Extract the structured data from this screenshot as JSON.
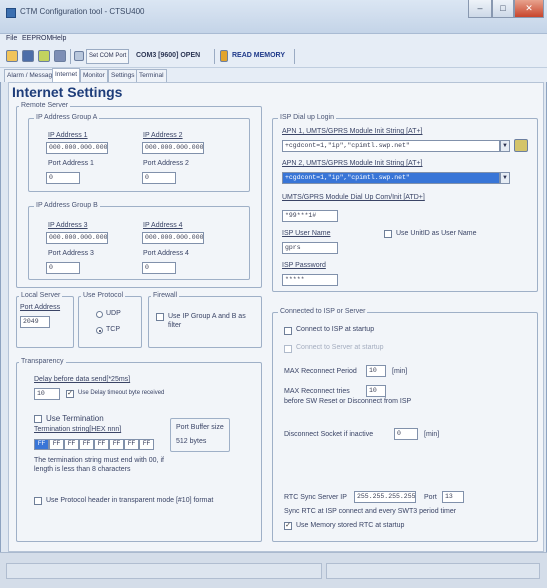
{
  "window": {
    "title": "CTM Configuration tool - CTSU400",
    "buttons": {
      "minimize": "–",
      "maximize": "□",
      "close": "✕"
    }
  },
  "menu": [
    "File",
    "EEPROM",
    "Help"
  ],
  "toolbar": {
    "set_com_port": "Set COM Port",
    "port_status": "COM3 [9600] OPEN",
    "read_memory": "READ MEMORY"
  },
  "tabs": [
    "Alarm / Message",
    "Internet",
    "Monitor",
    "Settings",
    "Terminal"
  ],
  "active_tab": "Internet",
  "page_title": "Internet Settings",
  "remote_server": {
    "label": "Remote Server",
    "group_a": {
      "label": "IP Address Group A",
      "ip1_label": "IP Address 1",
      "ip1": "000.000.000.000",
      "ip2_label": "IP Address 2",
      "ip2": "000.000.000.000",
      "port1_label": "Port Address 1",
      "port1": "0",
      "port2_label": "Port Address 2",
      "port2": "0"
    },
    "group_b": {
      "label": "IP Address Group B",
      "ip3_label": "IP Address 3",
      "ip3": "000.000.000.000",
      "ip4_label": "IP Address 4",
      "ip4": "000.000.000.000",
      "port3_label": "Port Address 3",
      "port3": "0",
      "port4_label": "Port Address 4",
      "port4": "0"
    }
  },
  "local_server": {
    "label": "Local Server",
    "port_label": "Port Address",
    "port": "2049"
  },
  "use_protocol": {
    "label": "Use Protocol",
    "udp": "UDP",
    "tcp": "TCP",
    "selected": "TCP"
  },
  "firewall": {
    "label": "Firewall",
    "option": "Use IP Group A and B as filter"
  },
  "transparency": {
    "label": "Transparency",
    "delay_label": "Delay before data send[*25ms]",
    "delay": "10",
    "delay_check": "Use Delay timeout byte received",
    "use_termination": "Use Termination",
    "term_label": "Termination string[HEX nnn]",
    "term_bytes": [
      "FF",
      "FF",
      "FF",
      "FF",
      "FF",
      "FF",
      "FF",
      "FF"
    ],
    "buffer_label": "Port Buffer size",
    "buffer_value": "512 bytes",
    "note": "The termination string must end with 00, if length is less than 8 characters",
    "protocol_header": "Use Protocol header in transparent mode [#10] format"
  },
  "isp_dial": {
    "label": "ISP Dial up Login",
    "apn1_label": "APN 1, UMTS/GPRS Module Init String [AT+]",
    "apn1": "+cgdcont=1,\"ip\",\"cpimtl.swp.net\"",
    "apn2_label": "APN 2, UMTS/GPRS Module Init String [AT+]",
    "apn2": "+cgdcont=1,\"ip\",\"cpimtl.swp.net\"",
    "dial_label": "UMTS/GPRS Module Dial Up Com/Init [ATD+]",
    "dial": "*99***1#",
    "user_label": "ISP User Name",
    "use_imei": "Use UnitID as User Name",
    "user": "gprs",
    "pass_label": "ISP Password",
    "pass": "*****"
  },
  "connected": {
    "label": "Connected to ISP or Server",
    "connect_startup": "Connect to ISP at startup",
    "connect_server": "Connect to Server at startup",
    "max_reconnect_label": "MAX Reconnect Period",
    "max_reconnect": "10",
    "min_unit": "[min]",
    "max_reconnect_tries_label": "MAX Reconnect tries",
    "max_reconnect_tries": "10",
    "tries_note": "before SW Reset or Disconnect from ISP",
    "disconnect_label": "Disconnect Socket if inactive",
    "disconnect": "0",
    "rtc_label": "RTC Sync Server IP",
    "rtc_ip": "255.255.255.255",
    "port_label": "Port",
    "rtc_port": "13",
    "rtc_note": "Sync RTC at ISP connect and every SWT3 period timer",
    "rtc_memory": "Use Memory stored RTC at startup"
  }
}
